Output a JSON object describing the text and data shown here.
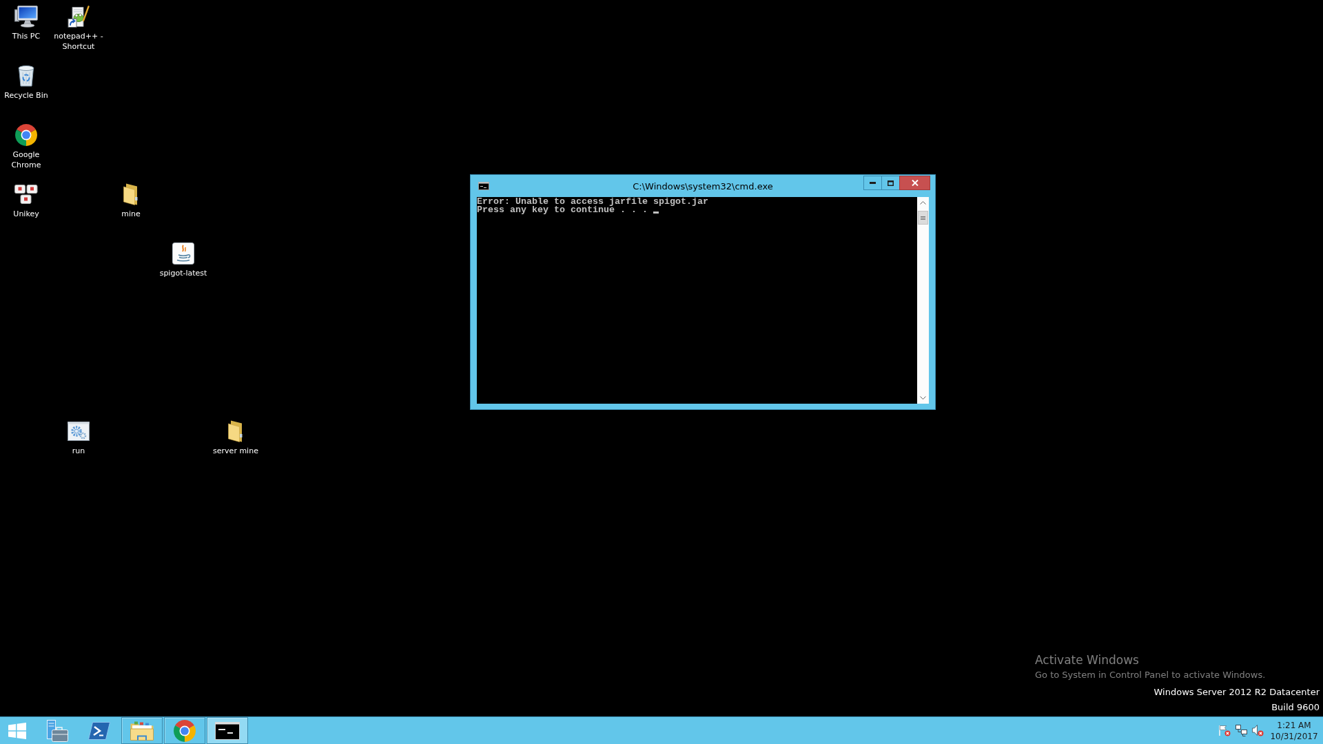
{
  "desktop": {
    "icons": [
      {
        "label": "This PC",
        "kind": "computer"
      },
      {
        "label": "notepad++ - Shortcut",
        "kind": "notepad"
      },
      {
        "label": "Recycle Bin",
        "kind": "recycle_bin"
      },
      {
        "label": "Google Chrome",
        "kind": "chrome"
      },
      {
        "label": "Unikey",
        "kind": "unikey"
      },
      {
        "label": "mine",
        "kind": "folder"
      },
      {
        "label": "spigot-latest",
        "kind": "java"
      },
      {
        "label": "run",
        "kind": "batch"
      },
      {
        "label": "server mine",
        "kind": "folder"
      }
    ]
  },
  "window": {
    "title": "C:\\Windows\\system32\\cmd.exe",
    "console": {
      "lines": [
        "Error: Unable to access jarfile spigot.jar",
        "Press any key to continue . . ."
      ],
      "cursor_visible": true
    }
  },
  "activation_notice": {
    "title": "Activate Windows",
    "message": "Go to System in Control Panel to activate Windows."
  },
  "edition": {
    "name": "Windows Server 2012 R2 Datacenter",
    "build": "Build 9600"
  },
  "taskbar": {
    "items": [
      {
        "kind": "server_manager",
        "running": false,
        "selected": false
      },
      {
        "kind": "powershell",
        "running": false,
        "selected": false
      },
      {
        "kind": "file_explorer",
        "running": true,
        "selected": false
      },
      {
        "kind": "chrome",
        "running": true,
        "selected": false
      },
      {
        "kind": "cmd",
        "running": true,
        "selected": true
      }
    ],
    "clock": {
      "time": "1:21 AM",
      "date": "10/31/2017"
    }
  }
}
